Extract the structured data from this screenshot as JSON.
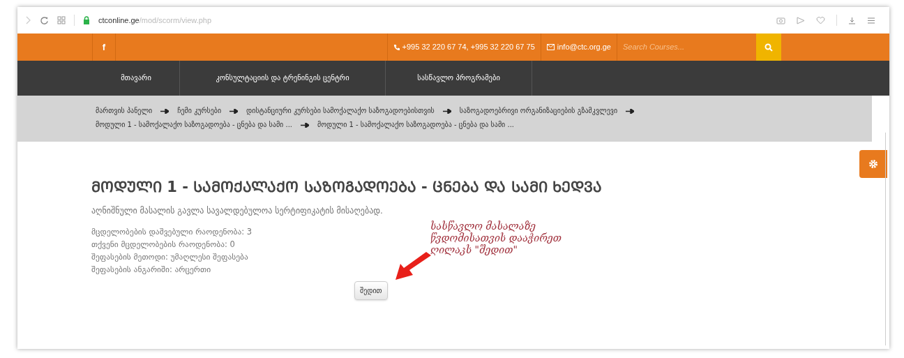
{
  "browser": {
    "url_host": "ctconline.ge",
    "url_path": "/mod/scorm/view.php"
  },
  "topbar": {
    "facebook": "f",
    "phones": "+995 32 220 67 74, +995 32 220 67 75",
    "email": "info@ctc.org.ge",
    "search": {
      "placeholder": "Search Courses..."
    }
  },
  "nav": [
    "მთავარი",
    "კონსულტაციის და ტრენინგის ცენტრი",
    "სასწავლო პროგრამები"
  ],
  "breadcrumb": [
    "მართვის პანელი",
    "ჩემი კურსები",
    "დისტანციური კურსები სამოქალაქო საზოგადოებისთვის",
    "საზოგადოებრივი ორგანიზაციების გზამკვლევი",
    "მოდული 1 - სამოქალაქო საზოგადოება - ცნება და სამი ...",
    "მოდული 1 - სამოქალაქო საზოგადოება - ცნება და სამი ..."
  ],
  "content": {
    "title": "ᲛᲝᲓᲣᲚᲘ 1 - ᲡᲐᲛᲝᲥᲐᲚᲐᲥᲝ ᲡᲐᲖᲝᲒᲐᲓᲝᲔᲑᲐ - ᲪᲜᲔᲑᲐ ᲓᲐ ᲡᲐᲛᲘ ᲮᲔᲓᲕᲐ",
    "intro": "აღნიშნული მასალის გავლა სავალდებულოა სერტიფიკატის მისაღებად.",
    "info": [
      "მცდელობების დაშვებული რაოდენობა: 3",
      "თქვენი მცდელობების რაოდენობა: 0",
      "შეფასების მეთოდი: უმაღლესი შეფასება",
      "შეფასების ანგარიში: არცერთი"
    ],
    "button": "შედით"
  },
  "annotation": [
    "სასწავლო მასალაზე",
    "წვდომისათვის დააჭირეთ",
    "ღილაკს \"შედით\""
  ]
}
